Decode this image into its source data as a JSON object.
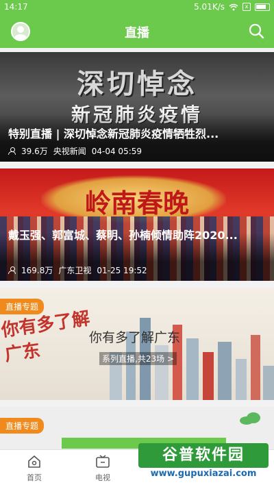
{
  "status_bar": {
    "time": "14:17",
    "network_speed": "5.01K/s",
    "x_badge": "x"
  },
  "header": {
    "title": "直播"
  },
  "cards": [
    {
      "image_text_1": "深切悼念",
      "image_text_2": "新冠肺炎疫情",
      "title": "特别直播 | 深切悼念新冠肺炎疫情牺牲烈...",
      "views": "39.6万",
      "channel": "央视新闻",
      "time": "04-04 05:59"
    },
    {
      "image_text_1": "岭南春晚",
      "title": "戴玉强、郭富城、蔡明、孙楠倾情助阵2020...",
      "views": "169.8万",
      "channel": "广东卫视",
      "time": "01-25 19:52"
    },
    {
      "tag": "直播专题",
      "logo_text": "你有多了解广东",
      "headline": "你有多了解广东",
      "series": "系列直播,共23场 >"
    },
    {
      "tag": "直播专题"
    }
  ],
  "tabbar": {
    "home": "首页",
    "tv": "电视"
  },
  "watermark": {
    "main": "谷普软件园",
    "url": "www.gupuxiazai.com"
  },
  "colors": {
    "brand_green": "#6bc94b",
    "tag_orange": "#f08a1c"
  }
}
